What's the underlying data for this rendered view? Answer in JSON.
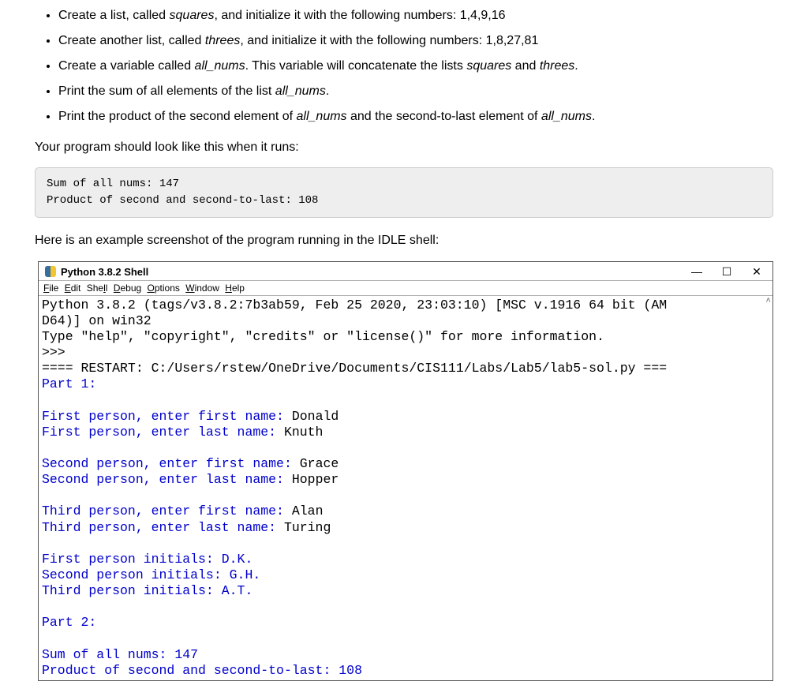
{
  "instructions": {
    "bullets": [
      {
        "pre": "Create a list, called ",
        "em1": "squares",
        "post": ", and initialize it with the following numbers: 1,4,9,16"
      },
      {
        "pre": "Create another list, called ",
        "em1": "threes",
        "post": ", and initialize it with the following numbers: 1,8,27,81"
      },
      {
        "pre": "Create a variable called ",
        "em1": "all_nums",
        "mid": ". This variable will concatenate the lists ",
        "em2": "squares",
        "mid2": " and ",
        "em3": "threes",
        "post": "."
      },
      {
        "pre": "Print the sum of all elements of the list ",
        "em1": "all_nums",
        "post": "."
      },
      {
        "pre": "Print the product of the second element of ",
        "em1": "all_nums",
        "mid": " and the second-to-last element of ",
        "em2": "all_nums",
        "post": "."
      }
    ],
    "lead1": "Your program should look like this when it runs:",
    "output_line1": "Sum of all nums: 147",
    "output_line2": "Product of second and second-to-last: 108",
    "lead2": "Here is an example screenshot of the program running in the IDLE shell:"
  },
  "idle": {
    "title": "Python 3.8.2 Shell",
    "menu": [
      "File",
      "Edit",
      "Shell",
      "Debug",
      "Options",
      "Window",
      "Help"
    ],
    "controls": {
      "min": "—",
      "max": "☐",
      "close": "✕"
    },
    "line_python": "Python 3.8.2 (tags/v3.8.2:7b3ab59, Feb 25 2020, 23:03:10) [MSC v.1916 64 bit (AM",
    "line_d64": "D64)] on win32",
    "line_type": "Type \"help\", \"copyright\", \"credits\" or \"license()\" for more information.",
    "prompt": ">>>",
    "restart_pre": "==== RESTART: ",
    "restart_path": "C:/Users/rstew/OneDrive/Documents/CIS111/Labs/Lab5/lab5-sol.py",
    "restart_post": " ===",
    "part1": "Part 1:",
    "p1_l1a": "First person, enter first name: ",
    "p1_l1b": "Donald",
    "p1_l2a": "First person, enter last name: ",
    "p1_l2b": "Knuth",
    "p1_l3a": "Second person, enter first name: ",
    "p1_l3b": "Grace",
    "p1_l4a": "Second person, enter last name: ",
    "p1_l4b": "Hopper",
    "p1_l5a": "Third person, enter first name: ",
    "p1_l5b": "Alan",
    "p1_l6a": "Third person, enter last name: ",
    "p1_l6b": "Turing",
    "inits1": "First person initials: D.K.",
    "inits2": "Second person initials: G.H.",
    "inits3": "Third person initials: A.T.",
    "part2": "Part 2:",
    "sum": "Sum of all nums: 147",
    "prod": "Product of second and second-to-last: 108",
    "scroll_hint": "^"
  }
}
